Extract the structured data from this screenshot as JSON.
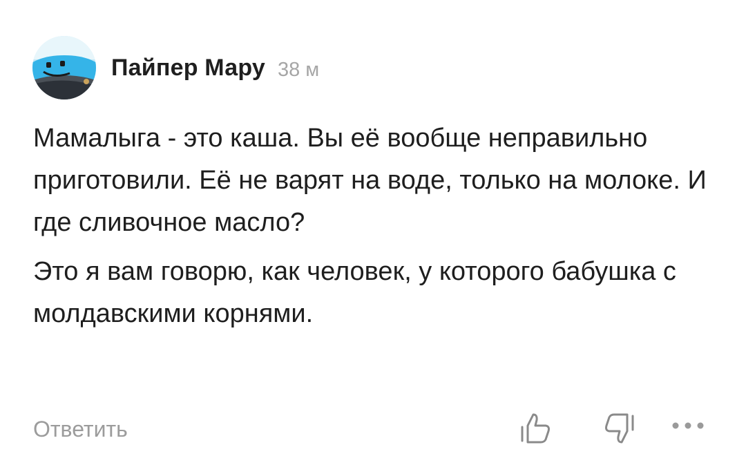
{
  "comment": {
    "author": "Пайпер Мару",
    "time": "38 м",
    "paragraphs": [
      "Мамалыга - это каша. Вы её вообще неправильно приготовили. Её не варят на воде, только на молоке. И где сливочное масло?",
      "Это я вам говорю, как человек, у которого бабушка с молдавскими корнями."
    ],
    "reply_label": "Ответить"
  },
  "icons": {
    "avatar": "avatar-smiling-sky-photo",
    "like": "thumbs-up-icon",
    "dislike": "thumbs-down-icon",
    "more": "more-dots-icon"
  },
  "colors": {
    "text": "#1e1e1e",
    "muted": "#9c9c9c",
    "time": "#a6a6a6",
    "avatar_sky": "#3ab6e6"
  }
}
